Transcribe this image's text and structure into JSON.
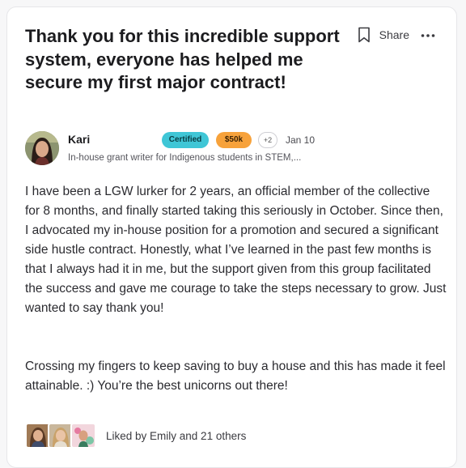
{
  "post": {
    "title": "Thank you for this incredible support system, everyone has helped me secure my first major contract!",
    "paragraphs": [
      "I have been a LGW lurker for 2 years, an official member of the collective for 8 months, and finally started taking this seriously in October. Since then, I advocated my in-house position for a promotion and secured a significant side hustle contract. Honestly, what I’ve learned in the past few months is that I always had it in me, but the support given from this group facilitated the success and gave me courage to take the steps necessary to grow. Just wanted to say thank you!",
      "Crossing my fingers to keep saving to buy a house and this has made it feel attainable. :) You’re the best unicorns out there!"
    ]
  },
  "actions": {
    "share_label": "Share",
    "bookmark_icon": "bookmark-icon",
    "more_icon": "more-dots-icon"
  },
  "author": {
    "name": "Kari",
    "badges": [
      "Certified",
      "$50k",
      "+2"
    ],
    "date": "Jan 10",
    "bio": "In-house grant writer for Indigenous students in STEM,..."
  },
  "likes": {
    "text": "Liked by Emily and 21 others",
    "avatar_count": 3
  },
  "colors": {
    "certified_badge": "#3fc6d6",
    "money_badge": "#f7a23b",
    "title_text": "#1c1c1f"
  }
}
